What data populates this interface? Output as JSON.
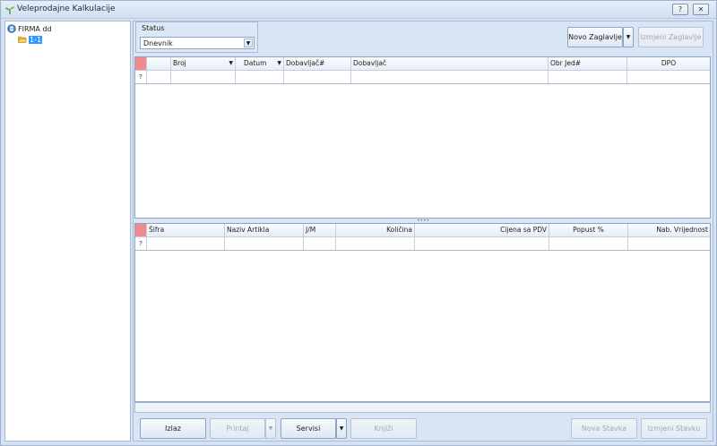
{
  "window": {
    "title": "Veleprodajne Kalkulacije",
    "help_label": "?",
    "close_label": "✕"
  },
  "tree": {
    "root_label": "FIRMA dd",
    "child_label": "1-1"
  },
  "status": {
    "caption": "Status",
    "selected": "Dnevnik"
  },
  "toolbar": {
    "new_header": "Novo Zaglavlje",
    "edit_header": "Izmjeni Zaglavlje"
  },
  "header_grid": {
    "columns": [
      "",
      "Broj",
      "Datum",
      "Dobavljač#",
      "Dobavljač",
      "Obr Jed#",
      "DPO"
    ]
  },
  "items_grid": {
    "columns": [
      "Šifra",
      "Naziv Artikla",
      "J/M",
      "Količina",
      "Cijena sa PDV",
      "Popust %",
      "Nab. Vrijednost"
    ]
  },
  "filter_icon": "?",
  "bottom": {
    "exit": "Izlaz",
    "print": "Printaj",
    "services": "Servisi",
    "post": "Knjiži",
    "new_item": "Nova Stavka",
    "edit_item": "Izmjeni Stavku"
  },
  "colors": {
    "row_indicator": "#f08a8f",
    "selection": "#3399ff",
    "panel_bg": "#d9e5f4"
  },
  "icons": {
    "app": "plant-icon",
    "root": "database-icon",
    "child": "folder-open-icon"
  }
}
